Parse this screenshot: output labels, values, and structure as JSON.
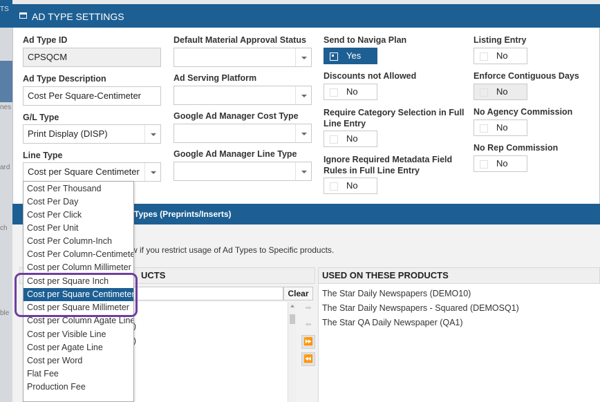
{
  "background": {
    "fragments": [
      "TS",
      "nes",
      "ard",
      "ch",
      "ble"
    ]
  },
  "panel": {
    "title": "AD TYPE SETTINGS",
    "accent_color": "#1d5f93",
    "highlight_color": "#6f3ea0"
  },
  "form": {
    "ad_type_id": {
      "label": "Ad Type ID",
      "value": "CPSQCM"
    },
    "ad_type_description": {
      "label": "Ad Type Description",
      "value": "Cost Per Square-Centimeter"
    },
    "gl_type": {
      "label": "G/L Type",
      "value": "Print Display (DISP)"
    },
    "line_type": {
      "label": "Line Type",
      "value": "Cost per Square Centimeter"
    },
    "default_material_approval_status": {
      "label": "Default Material Approval Status",
      "value": ""
    },
    "ad_serving_platform": {
      "label": "Ad Serving Platform",
      "value": ""
    },
    "gam_cost_type": {
      "label": "Google Ad Manager Cost Type",
      "value": ""
    },
    "gam_line_type": {
      "label": "Google Ad Manager Line Type",
      "value": ""
    }
  },
  "toggles": {
    "send_to_naviga_plan": {
      "label": "Send to Naviga Plan",
      "value": "Yes"
    },
    "discounts_not_allowed": {
      "label": "Discounts not Allowed",
      "value": "No"
    },
    "require_category_selection": {
      "label": "Require Category Selection in Full Line Entry",
      "value": "No"
    },
    "ignore_required_metadata": {
      "label": "Ignore Required Metadata Field Rules in Full Line Entry",
      "value": "No"
    },
    "listing_entry": {
      "label": "Listing Entry",
      "value": "No"
    },
    "enforce_contiguous_days": {
      "label": "Enforce Contiguous Days",
      "value": "No"
    },
    "no_agency_commission": {
      "label": "No Agency Commission",
      "value": "No"
    },
    "no_rep_commission": {
      "label": "No Rep Commission",
      "value": "No"
    }
  },
  "line_type_dropdown": {
    "options": [
      "Cost Per Thousand",
      "Cost Per Day",
      "Cost Per Click",
      "Cost Per Unit",
      "Cost Per Column-Inch",
      "Cost Per Column-Centimeter",
      "Cost per Column Millimeter",
      "Cost per Square Inch",
      "Cost per Square Centimeter",
      "Cost per Square Millimeter",
      "Cost per Column Agate Line",
      "Cost per Visible Line",
      "Cost per Agate Line",
      "Cost per Word",
      "Flat Fee",
      "Production Fee"
    ],
    "selected": "Cost per Square Centimeter"
  },
  "products_section": {
    "title_fragment": "Types (Preprints/Inserts)",
    "hint_fragment": "w if you restrict usage of Ad Types to Specific products.",
    "available_header_fragment": "UCTS",
    "used_header": "USED ON THESE PRODUCTS",
    "clear_label": "Clear",
    "available_fragments": [
      ")",
      ")"
    ],
    "used_products": [
      "The Star Daily Newspapers (DEMO10)",
      "The Star Daily Newspapers - Squared (DEMOSQ1)",
      "The Star QA Daily Newspaper (QA1)"
    ],
    "move_buttons": {
      "add_one": "➡",
      "remove_one": "⬅",
      "add_all": "⏩",
      "remove_all": "⏪"
    }
  }
}
